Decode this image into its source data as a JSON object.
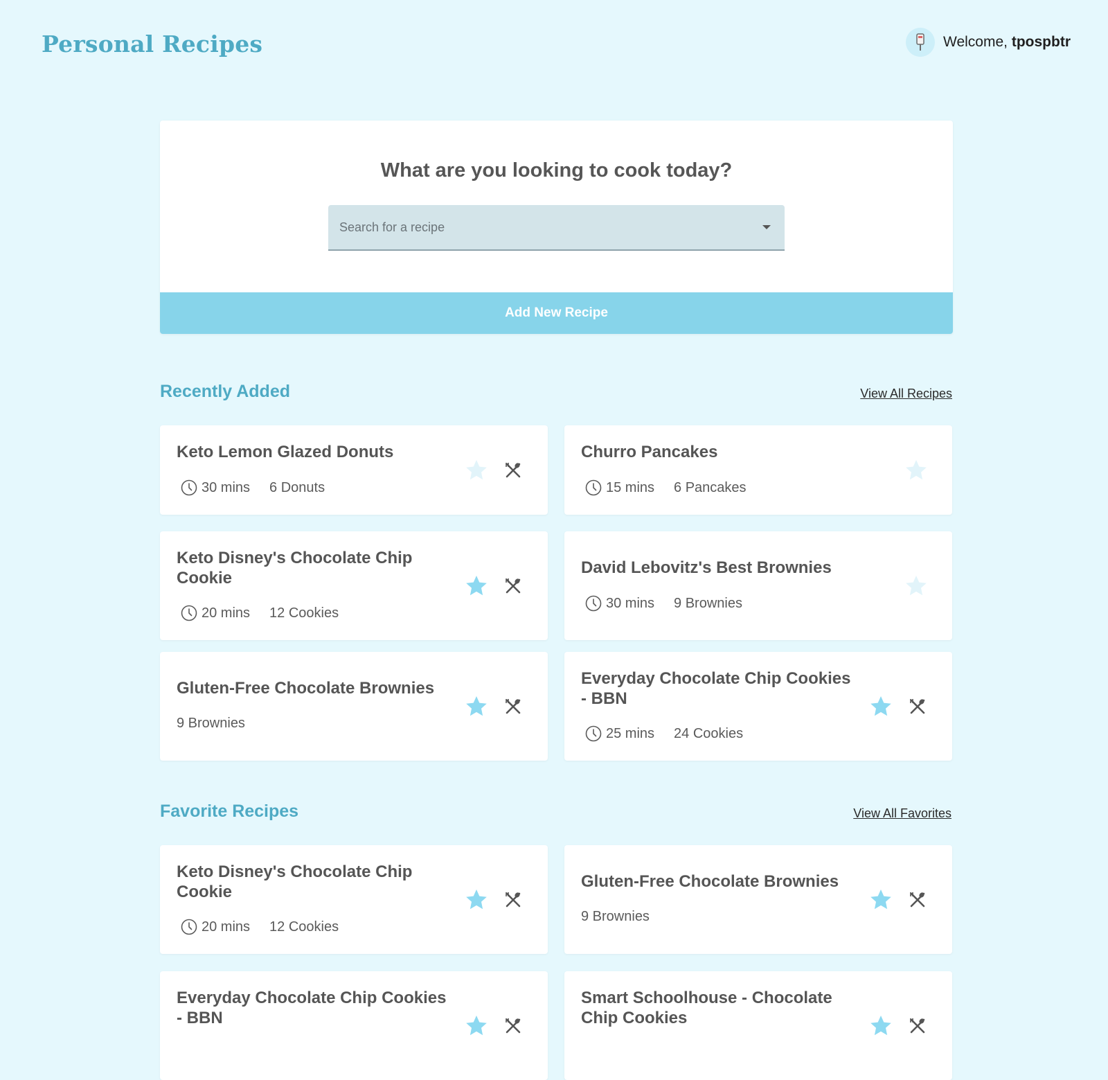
{
  "header": {
    "brand": "Personal Recipes",
    "welcome_prefix": "Welcome,",
    "username": "tpospbtr"
  },
  "hero": {
    "heading": "What are you looking to cook today?",
    "search_placeholder": "Search for a recipe",
    "add_button": "Add New Recipe"
  },
  "recent": {
    "title": "Recently Added",
    "view_all": "View All Recipes",
    "cards": [
      {
        "title": "Keto Lemon Glazed Donuts",
        "time": "30 mins",
        "yield": "6 Donuts",
        "favorite": false,
        "cook_icon": true
      },
      {
        "title": "Churro Pancakes",
        "time": "15 mins",
        "yield": "6 Pancakes",
        "favorite": false,
        "cook_icon": false
      },
      {
        "title": "Keto Disney's Chocolate Chip Cookie",
        "time": "20 mins",
        "yield": "12 Cookies",
        "favorite": true,
        "cook_icon": true
      },
      {
        "title": "David Lebovitz's Best Brownies",
        "time": "30 mins",
        "yield": "9 Brownies",
        "favorite": false,
        "cook_icon": false
      },
      {
        "title": "Gluten-Free Chocolate Brownies",
        "time": "",
        "yield": "9 Brownies",
        "favorite": true,
        "cook_icon": true
      },
      {
        "title": "Everyday Chocolate Chip Cookies - BBN",
        "time": "25 mins",
        "yield": "24 Cookies",
        "favorite": true,
        "cook_icon": true
      }
    ]
  },
  "favorites": {
    "title": "Favorite Recipes",
    "view_all": "View All Favorites",
    "cards": [
      {
        "title": "Keto Disney's Chocolate Chip Cookie",
        "time": "20 mins",
        "yield": "12 Cookies",
        "favorite": true,
        "cook_icon": true
      },
      {
        "title": "Gluten-Free Chocolate Brownies",
        "time": "",
        "yield": "9 Brownies",
        "favorite": true,
        "cook_icon": true
      },
      {
        "title": "Everyday Chocolate Chip Cookies - BBN",
        "time": "",
        "yield": "",
        "favorite": true,
        "cook_icon": true
      },
      {
        "title": "Smart Schoolhouse - Chocolate Chip Cookies",
        "time": "",
        "yield": "",
        "favorite": true,
        "cook_icon": true
      }
    ]
  },
  "colors": {
    "background": "#e5f8fd",
    "accent": "#4eaac4",
    "button": "#87d4ea",
    "star_on": "#8dd9f1",
    "star_off": "#e2f4fa",
    "text": "#555555"
  },
  "icons": [
    "avatar-icon",
    "chevron-down-icon",
    "clock-icon",
    "star-icon",
    "utensils-icon"
  ]
}
